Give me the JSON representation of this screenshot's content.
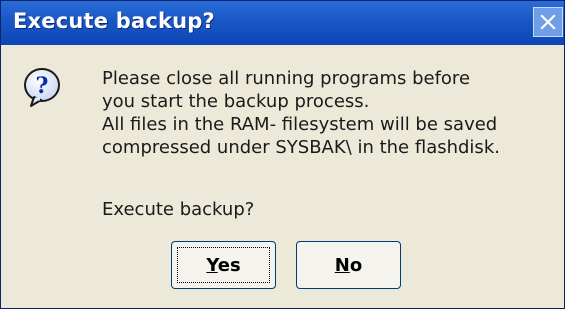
{
  "dialog": {
    "title": "Execute backup?",
    "message_lines": [
      "Please close all running programs before",
      "you start the backup process.",
      "All files in the RAM- filesystem will be saved",
      "compressed under SYSBAK\\ in the flashdisk."
    ],
    "prompt": "Execute backup?",
    "icon": "question-icon"
  },
  "buttons": {
    "yes": {
      "mnemonic": "Y",
      "rest": "es"
    },
    "no": {
      "mnemonic": "N",
      "rest": "o"
    },
    "close": "close-icon"
  },
  "colors": {
    "titlebar": "#1a57c6",
    "dialog_bg": "#ece9d8",
    "close_btn": "#6f9ee8",
    "button_border": "#003c74"
  }
}
